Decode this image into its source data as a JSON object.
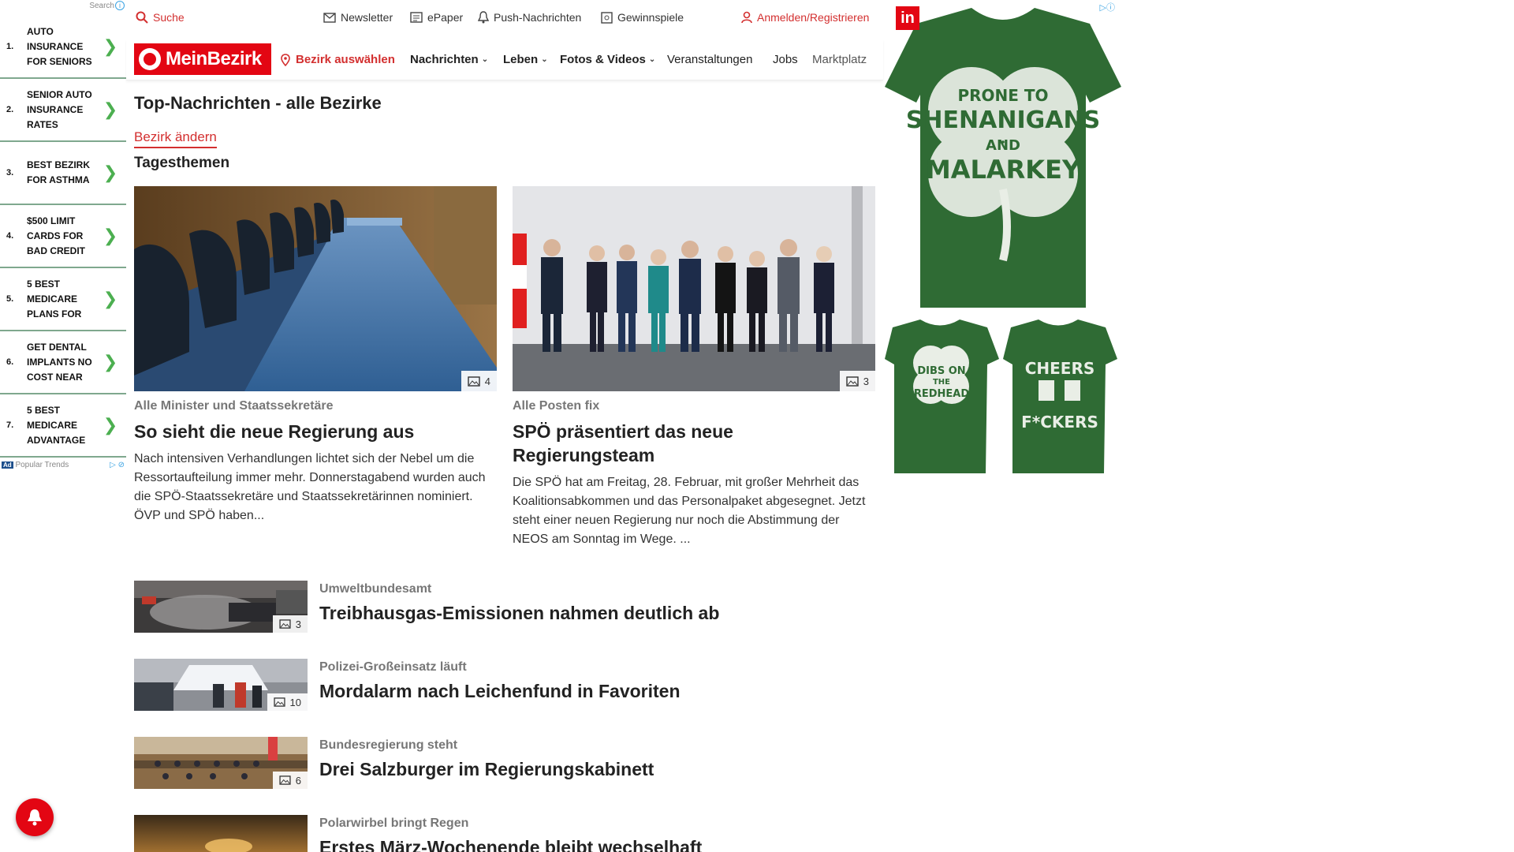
{
  "left_ad": {
    "search_label": "Search",
    "items": [
      {
        "num": "1.",
        "text": "AUTO INSURANCE FOR SENIORS"
      },
      {
        "num": "2.",
        "text": "SENIOR AUTO INSURANCE RATES"
      },
      {
        "num": "3.",
        "text": "BEST BEZIRK FOR ASTHMA"
      },
      {
        "num": "4.",
        "text": "$500 LIMIT CARDS FOR BAD CREDIT"
      },
      {
        "num": "5.",
        "text": "5 BEST MEDICARE PLANS FOR"
      },
      {
        "num": "6.",
        "text": "GET DENTAL IMPLANTS NO COST NEAR"
      },
      {
        "num": "7.",
        "text": "5 BEST MEDICARE ADVANTAGE"
      }
    ],
    "footer_badge": "Ad",
    "footer_label": "Popular Trends"
  },
  "utility": {
    "search": "Suche",
    "newsletter": "Newsletter",
    "epaper": "ePaper",
    "push": "Push-Nachrichten",
    "gewinnspiele": "Gewinnspiele",
    "login": "Anmelden/Registrieren"
  },
  "nav": {
    "logo_text": "MeinBezirk",
    "bezirk_select": "Bezirk auswählen",
    "items": [
      "Nachrichten",
      "Leben",
      "Fotos & Videos",
      "Veranstaltungen",
      "Jobs",
      "Marktplatz"
    ]
  },
  "main": {
    "page_title": "Top-Nachrichten - alle Bezirke",
    "bezirk_change": "Bezirk ändern",
    "section_title": "Tagesthemen",
    "featured": [
      {
        "kicker": "Alle Minister und Staatssekretäre",
        "headline": "So sieht die neue Regierung aus",
        "teaser": "Nach intensiven Verhandlungen lichtet sich der Nebel um die Ressortaufteilung immer mehr. Donnerstagabend wurden auch die SPÖ-Staatssekretäre und Staatssekretärinnen nominiert. ÖVP und SPÖ haben...",
        "photo_count": "4"
      },
      {
        "kicker": "Alle Posten fix",
        "headline": "SPÖ präsentiert das neue Regierungsteam",
        "teaser": "Die SPÖ hat am Freitag, 28. Februar, mit großer Mehrheit das Koalitionsabkommen und das Personalpaket abgesegnet. Jetzt steht einer neuen Regierung nur noch die Abstimmung der NEOS am Sonntag im Wege. ...",
        "photo_count": "3"
      }
    ],
    "list": [
      {
        "kicker": "Umweltbundesamt",
        "headline": "Treibhausgas-Emissionen nahmen deutlich ab",
        "photo_count": "3"
      },
      {
        "kicker": "Polizei-Großeinsatz läuft",
        "headline": "Mordalarm nach Leichenfund in Favoriten",
        "photo_count": "10"
      },
      {
        "kicker": "Bundesregierung steht",
        "headline": "Drei Salzburger im Regierungskabinett",
        "photo_count": "6"
      },
      {
        "kicker": "Polarwirbel bringt Regen",
        "headline": "Erstes März-Wochenende bleibt wechselhaft",
        "photo_count": ""
      }
    ]
  },
  "right_ad": {
    "badge": "in",
    "shirt1": [
      "PRONE TO",
      "SHENANIGANS",
      "AND",
      "MALARKEY"
    ],
    "shirt2": [
      "DIBS ON",
      "THE",
      "REDHEAD"
    ],
    "shirt3": [
      "CHEERS",
      "F*CKERS"
    ]
  },
  "colors": {
    "brand": "#e30613",
    "accent_red": "#d32f2f",
    "shirt_green": "#2f6b34"
  }
}
